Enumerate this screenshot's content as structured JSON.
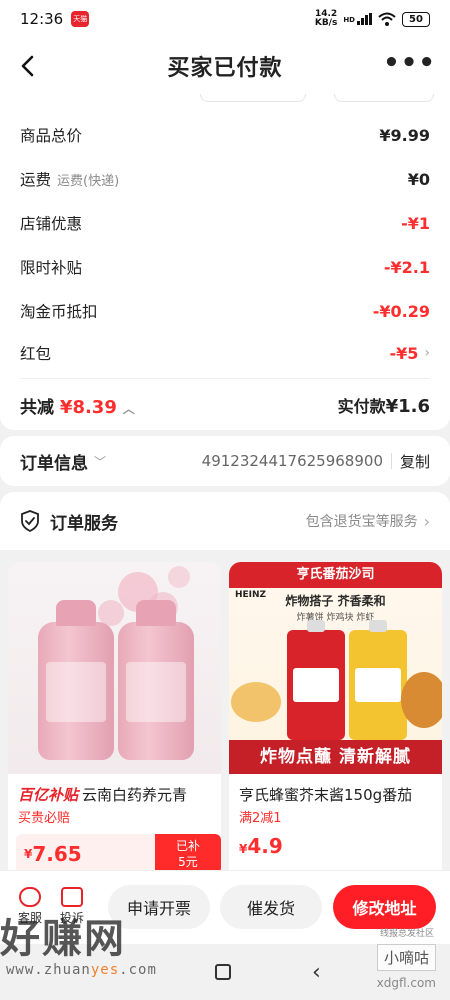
{
  "status_bar": {
    "time": "12:36",
    "app_badge": "天猫",
    "net_speed_top": "14.2",
    "net_speed_bottom": "KB/s",
    "net_type": "HD",
    "battery": "50"
  },
  "header": {
    "title": "买家已付款"
  },
  "price_details": {
    "rows": [
      {
        "label": "商品总价",
        "sub": "",
        "value": "¥9.99",
        "red": false
      },
      {
        "label": "运费",
        "sub": "运费(快递)",
        "value": "¥0",
        "red": false
      },
      {
        "label": "店铺优惠",
        "sub": "",
        "value": "-¥1",
        "red": true
      },
      {
        "label": "限时补贴",
        "sub": "",
        "value": "-¥2.1",
        "red": true
      },
      {
        "label": "淘金币抵扣",
        "sub": "",
        "value": "-¥0.29",
        "red": true
      },
      {
        "label": "红包",
        "sub": "",
        "value": "-¥5",
        "red": true
      }
    ],
    "total_label": "共减",
    "total_amount": "¥8.39",
    "paid_label": "实付款",
    "paid_amount": "¥1.6"
  },
  "order_info": {
    "title": "订单信息",
    "order_number": "4912324417625968900",
    "copy_label": "复制"
  },
  "order_service": {
    "title": "订单服务",
    "summary": "包含退货宝等服务"
  },
  "products": [
    {
      "tag": "百亿补贴",
      "title": "云南白药养元青",
      "subtitle": "买贵必赔",
      "price_symbol": "¥",
      "price": "7.65",
      "subsidy_label": "已补",
      "subsidy_value": "5元"
    },
    {
      "tag": "",
      "title": "亨氏蜂蜜芥末酱150g番茄",
      "subtitle": "满2减1",
      "price_symbol": "¥",
      "price": "4.9",
      "banner": "亨氏番茄沙司",
      "brand": "HEINZ",
      "slogan": "炸物搭子 芥香柔和",
      "slogan_sub": "炸薯饼 炸鸡块 炸虾",
      "footer": "炸物点蘸 清新解腻"
    }
  ],
  "bottom_bar": {
    "service_label": "客服",
    "complain_label": "投诉",
    "invoice_button": "申请开票",
    "urge_button": "催发货",
    "modify_address_button": "修改地址"
  },
  "watermark": {
    "logo": "好赚网",
    "url_prefix": "www.zhuan",
    "url_mid": "yes",
    "url_suffix": ".com",
    "right_small": "线报总发社区",
    "right_logo": "小嘀咕",
    "right_url": "xdgfl.com"
  }
}
